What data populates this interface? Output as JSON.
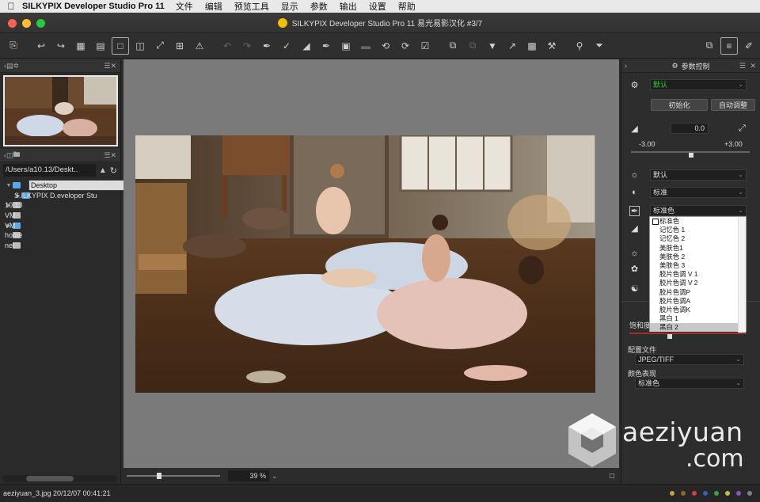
{
  "menubar": {
    "app_name": "SILKYPIX Developer Studio Pro 11",
    "items": [
      "文件",
      "编辑",
      "预览工具",
      "显示",
      "参数",
      "输出",
      "设置",
      "帮助"
    ]
  },
  "window": {
    "title": "SILKYPIX Developer Studio Pro 11 易光易影汉化  #3/7"
  },
  "left_panel": {
    "path": "/Users/a10.13/Deskt..",
    "tree": [
      {
        "label": "Desktop",
        "level": 0,
        "arrow": "▼",
        "icon": "folder",
        "selected": true
      },
      {
        "label": "S.ILKYPIX D.eveloper Stu",
        "level": 1,
        "arrow": "▶",
        "icon": "folder",
        "selected": false
      },
      {
        "label": "10.13",
        "level": 0,
        "arrow": "▶",
        "icon": "disk",
        "selected": false
      },
      {
        "label": "VM",
        "level": 0,
        "arrow": "",
        "icon": "disk",
        "selected": false
      },
      {
        "label": "VM",
        "level": 0,
        "arrow": "▶",
        "icon": "folder",
        "selected": false
      },
      {
        "label": "home",
        "level": 0,
        "arrow": "",
        "icon": "disk",
        "selected": false
      },
      {
        "label": "net",
        "level": 0,
        "arrow": "",
        "icon": "disk",
        "selected": false
      }
    ]
  },
  "viewer": {
    "zoom": "39 %"
  },
  "right_panel": {
    "header": "参数控制",
    "preset_value": "默认",
    "init_button": "初始化",
    "auto_button": "自动调整",
    "exposure_value": "0.0",
    "exposure_min": "-3.00",
    "exposure_max": "+3.00",
    "exposure_level": 0.5,
    "white_balance_value": "默认",
    "tone_value": "标准",
    "color_value": "标准色",
    "saturation_label": "饱和度",
    "saturation_level": 0.5,
    "profile_label": "配置文件",
    "profile_value": "JPEG/TIFF",
    "color_expression_label": "颜色表现",
    "color_expression_value": "标准色"
  },
  "color_dropdown": {
    "options": [
      "标准色",
      "记忆色 1",
      "记忆色 2",
      "美肤色1",
      "美肤色 2",
      "美肤色 3",
      "胶片色调 V 1",
      "胶片色调 V 2",
      "胶片色调P",
      "胶片色调A",
      "胶片色调K",
      "黑白 1",
      "黑白 2"
    ],
    "checked_index": 0,
    "highlighted_index": 12
  },
  "status": {
    "file_info": "aeziyuan_3.jpg 20/12/07 00:41:21",
    "dot_colors": [
      "#c8a040",
      "#8a6a2a",
      "#d04040",
      "#3060c0",
      "#3aa040",
      "#c0c040",
      "#9050c0",
      "#808080"
    ]
  },
  "watermark": {
    "line1": "aeziyuan",
    "line2": ".com"
  },
  "colors": {
    "accent_green": "#2ecc2e",
    "highlight": "#c8c8c8"
  }
}
